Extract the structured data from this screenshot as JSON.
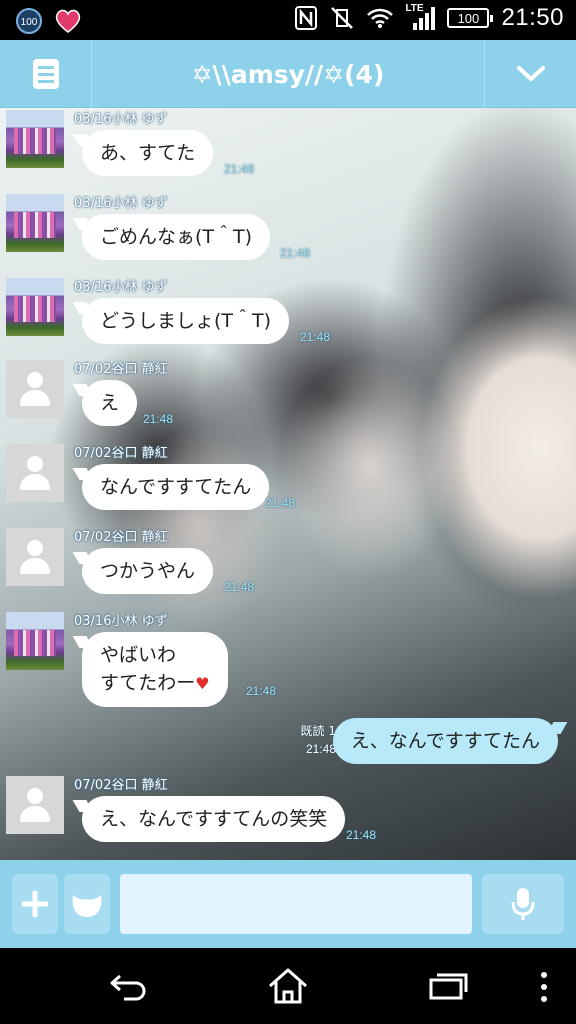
{
  "status_bar": {
    "time": "21:50",
    "battery": "100",
    "network": "LTE",
    "left_badge": "100"
  },
  "header": {
    "title": "✡\\\\amsy//✡(4)"
  },
  "messages": [
    {
      "sender": "03/16小林 ゆず",
      "avatar": "photo",
      "text": "あ、すてた",
      "time": "21:48"
    },
    {
      "sender": "03/16小林 ゆず",
      "avatar": "photo",
      "text": "ごめんなぁ(T＾T)",
      "time": "21:48"
    },
    {
      "sender": "03/16小林 ゆず",
      "avatar": "photo",
      "text": "どうしましょ(T＾T)",
      "time": "21:48"
    },
    {
      "sender": "07/02谷口 静紅",
      "avatar": "default",
      "text": "え",
      "time": "21:48"
    },
    {
      "sender": "07/02谷口 静紅",
      "avatar": "default",
      "text": "なんですすてたん",
      "time": "21:48"
    },
    {
      "sender": "07/02谷口 静紅",
      "avatar": "default",
      "text": "つかうやん",
      "time": "21:48"
    },
    {
      "sender": "03/16小林 ゆず",
      "avatar": "photo",
      "text_line1": "やばいわ",
      "text_line2": "すてたわー",
      "time": "21:48"
    },
    {
      "sender": "07/02谷口 静紅",
      "avatar": "default",
      "text": "え、なんですすてんの笑笑",
      "time": "21:48"
    }
  ],
  "sent_message": {
    "text": "え、なんですすてたん",
    "read_label": "既読 1",
    "time": "21:48"
  },
  "input_bar": {
    "placeholder": ""
  },
  "icons": [
    "menu-icon",
    "chevron-down-icon",
    "plus-icon",
    "emoji-icon",
    "mic-icon",
    "back-icon",
    "home-icon",
    "recent-apps-icon",
    "more-icon"
  ],
  "colors": {
    "header_bg": "#8ed1ea",
    "sent_bubble": "#b8e9f9",
    "time_text": "#9de0f5"
  }
}
